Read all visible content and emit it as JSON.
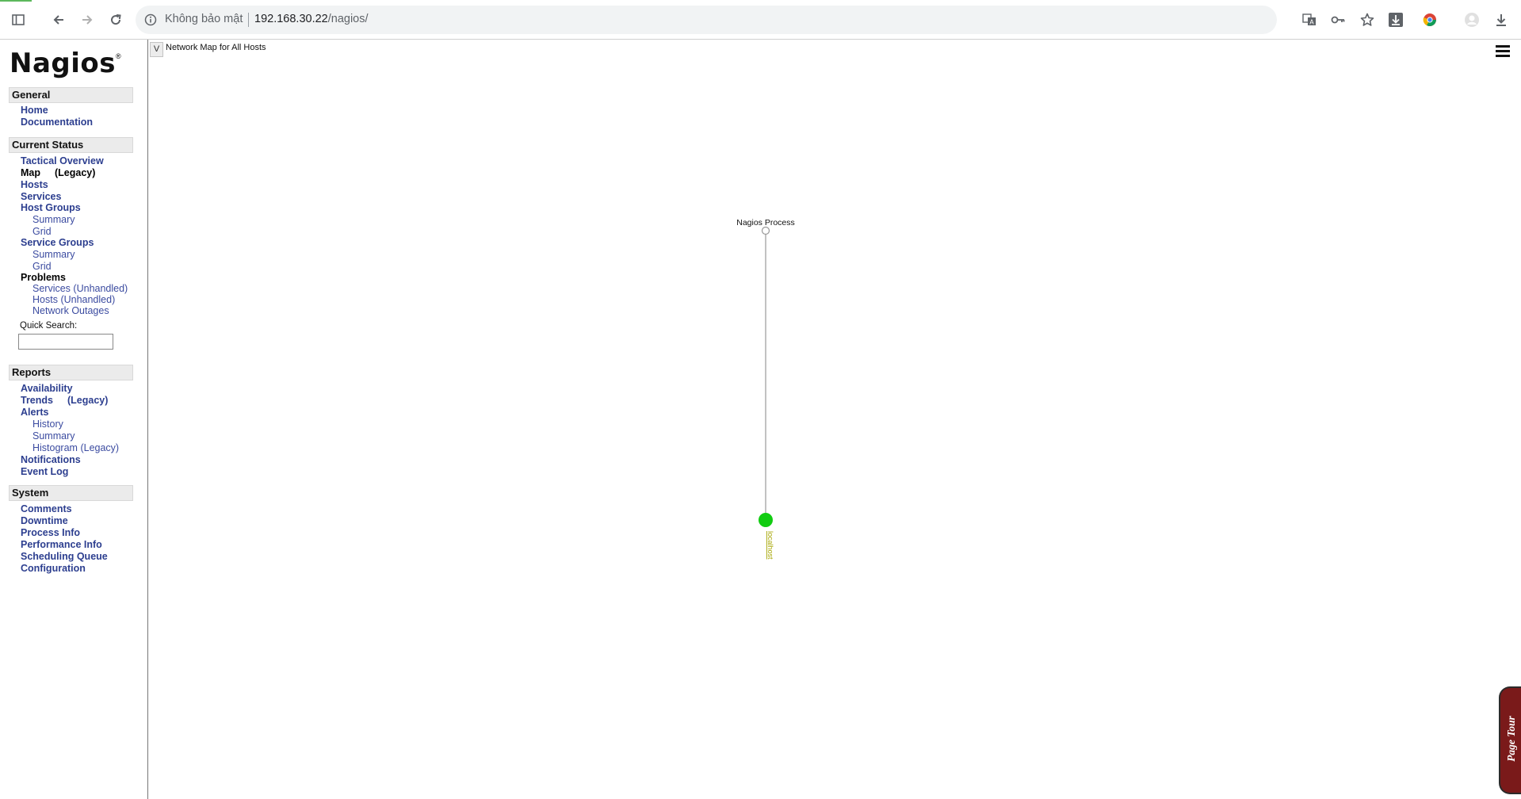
{
  "browser": {
    "security_label": "Không bảo mật",
    "url_host": "192.168.30.22",
    "url_path": "/nagios/",
    "icons": [
      "tab-search-icon",
      "back-icon",
      "forward-icon",
      "reload-icon",
      "info-icon",
      "translate-icon",
      "key-icon",
      "star-icon",
      "download-ext-icon",
      "chrome-ext-icon",
      "profile-icon",
      "download-icon"
    ]
  },
  "sidebar": {
    "logo_text": "Nagios",
    "logo_mark": "®",
    "general": {
      "heading": "General",
      "home": "Home",
      "documentation": "Documentation"
    },
    "current_status": {
      "heading": "Current Status",
      "tactical_overview": "Tactical Overview",
      "map": "Map",
      "map_legacy": "(Legacy)",
      "hosts": "Hosts",
      "services": "Services",
      "host_groups": "Host Groups",
      "hg_summary": "Summary",
      "hg_grid": "Grid",
      "service_groups": "Service Groups",
      "sg_summary": "Summary",
      "sg_grid": "Grid",
      "problems": "Problems",
      "prob_services": "Services",
      "prob_services_unhandled": "(Unhandled)",
      "prob_hosts": "Hosts",
      "prob_hosts_unhandled": "(Unhandled)",
      "network_outages": "Network Outages",
      "quick_search_label": "Quick Search:"
    },
    "reports": {
      "heading": "Reports",
      "availability": "Availability",
      "trends": "Trends",
      "trends_legacy": "(Legacy)",
      "alerts": "Alerts",
      "history": "History",
      "summary": "Summary",
      "histogram": "Histogram",
      "histogram_legacy": "(Legacy)",
      "notifications": "Notifications",
      "event_log": "Event Log"
    },
    "system": {
      "heading": "System",
      "comments": "Comments",
      "downtime": "Downtime",
      "process_info": "Process Info",
      "performance_info": "Performance Info",
      "scheduling_queue": "Scheduling Queue",
      "configuration": "Configuration"
    }
  },
  "map": {
    "toggle_label": "V",
    "title": "Network Map for All Hosts",
    "root_node": "Nagios Process",
    "host_node": "localhost",
    "host_status_color": "#11cc11",
    "link_color": "#999999",
    "page_tour": "Page Tour"
  }
}
